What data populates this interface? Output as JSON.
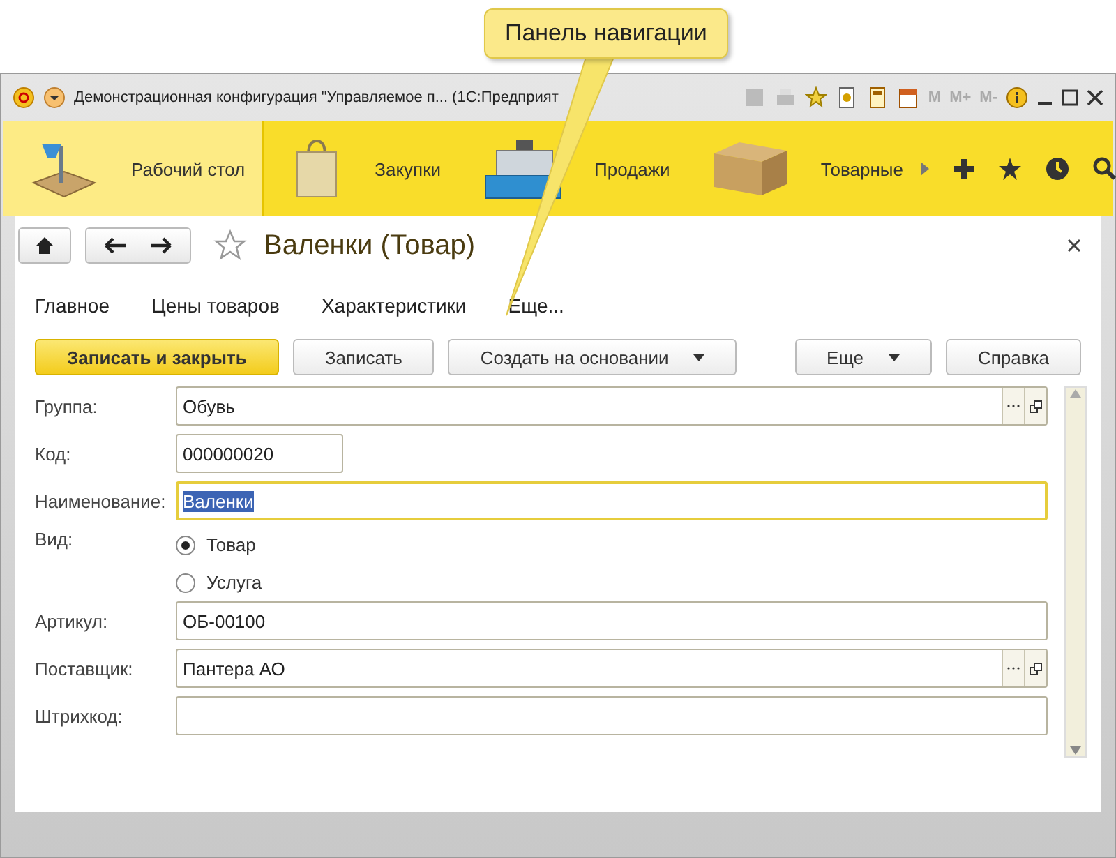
{
  "callout": {
    "text": "Панель навигации"
  },
  "window": {
    "title": "Демонстрационная конфигурация \"Управляемое п...  (1С:Предприят",
    "memory_buttons": [
      "M",
      "M+",
      "M-"
    ]
  },
  "sections": [
    {
      "label": "Рабочий стол",
      "selected": true
    },
    {
      "label": "Закупки",
      "selected": false
    },
    {
      "label": "Продажи",
      "selected": false
    },
    {
      "label": "Товарные",
      "selected": false
    }
  ],
  "form": {
    "title": "Валенки (Товар)",
    "nav_links": [
      {
        "label": "Главное",
        "selected": false
      },
      {
        "label": "Цены товаров",
        "selected": false
      },
      {
        "label": "Характеристики",
        "selected": false
      },
      {
        "label": "Еще...",
        "selected": false
      }
    ],
    "commands": [
      {
        "label": "Записать и закрыть",
        "kind": "primary"
      },
      {
        "label": "Записать",
        "kind": "plain"
      },
      {
        "label": "Создать на основании",
        "kind": "dropdown"
      }
    ],
    "commands_right": [
      {
        "label": "Еще",
        "kind": "dropdown"
      },
      {
        "label": "Справка",
        "kind": "plain"
      }
    ],
    "fields": [
      {
        "label": "Группа:",
        "kind": "choice",
        "value": "Обувь",
        "focused": false
      },
      {
        "label": "Код:",
        "kind": "short",
        "value": "000000020",
        "focused": false
      },
      {
        "label": "Наименование:",
        "kind": "text",
        "value": "Валенки",
        "focused": true
      },
      {
        "label": "Вид:",
        "kind": "radio",
        "options": [
          {
            "label": "Товар",
            "selected": true
          },
          {
            "label": "Услуга",
            "selected": false
          }
        ]
      },
      {
        "label": "Артикул:",
        "kind": "text",
        "value": "ОБ-00100",
        "focused": false
      },
      {
        "label": "Поставщик:",
        "kind": "choice",
        "value": "Пантера АО",
        "focused": false
      },
      {
        "label": "Штрихкод:",
        "kind": "text",
        "focused": false
      }
    ]
  }
}
